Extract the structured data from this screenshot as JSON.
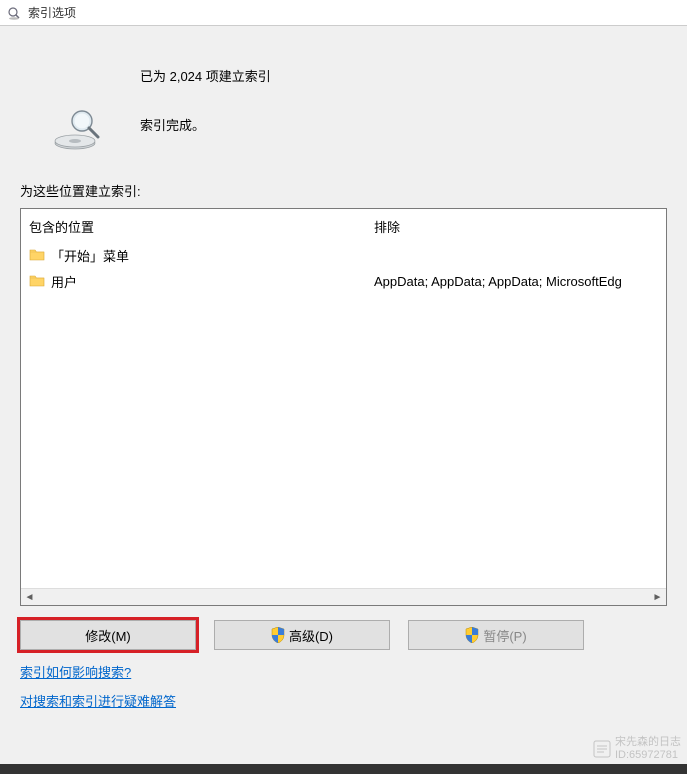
{
  "window": {
    "title": "索引选项"
  },
  "status": {
    "indexed_line": "已为 2,024 项建立索引",
    "complete_line": "索引完成。"
  },
  "section_label": "为这些位置建立索引:",
  "headers": {
    "included": "包含的位置",
    "excluded": "排除"
  },
  "rows": [
    {
      "name": "「开始」菜单",
      "excluded": ""
    },
    {
      "name": "用户",
      "excluded": "AppData; AppData; AppData; MicrosoftEdg"
    }
  ],
  "buttons": {
    "modify": "修改(M)",
    "advanced": "高级(D)",
    "pause": "暂停(P)"
  },
  "links": {
    "how_affect": "索引如何影响搜索?",
    "troubleshoot": "对搜索和索引进行疑难解答"
  },
  "watermark": {
    "line1": "宋先森的日志",
    "line2": "ID:65972781"
  }
}
